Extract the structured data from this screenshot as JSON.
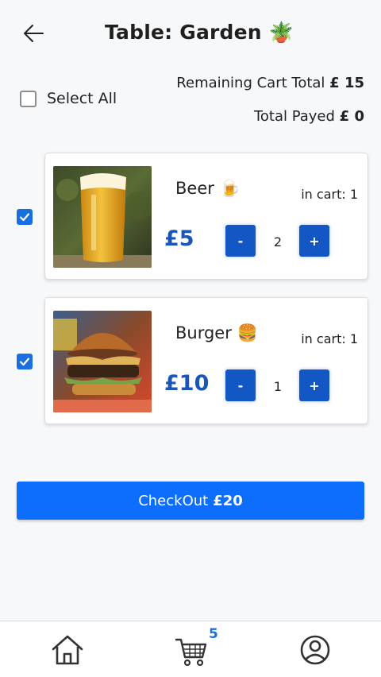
{
  "header": {
    "title": "Table: Garden",
    "title_emoji": "🪴",
    "back_icon": "arrow-left-icon"
  },
  "select_all": {
    "label": "Select All",
    "checked": false
  },
  "totals": {
    "remaining_label": "Remaining Cart Total",
    "remaining_value": "£ 15",
    "payed_label": "Total Payed",
    "payed_value": "£ 0"
  },
  "items": [
    {
      "name": "Beer",
      "emoji": "🍺",
      "in_cart": "in cart: 1",
      "price": "£5",
      "minus_label": "-",
      "quantity": "2",
      "plus_label": "+",
      "checked": true
    },
    {
      "name": "Burger",
      "emoji": "🍔",
      "in_cart": "in cart: 1",
      "price": "£10",
      "minus_label": "-",
      "quantity": "1",
      "plus_label": "+",
      "checked": true
    }
  ],
  "checkout": {
    "label": "CheckOut",
    "amount": "£20"
  },
  "nav": {
    "home_icon": "home-icon",
    "cart_icon": "cart-icon",
    "profile_icon": "user-circle-icon",
    "cart_badge": "5"
  },
  "colors": {
    "accent": "#0d6efd",
    "button": "#1257c4",
    "price": "#1a56b8",
    "checkbox": "#1a6fe0"
  }
}
